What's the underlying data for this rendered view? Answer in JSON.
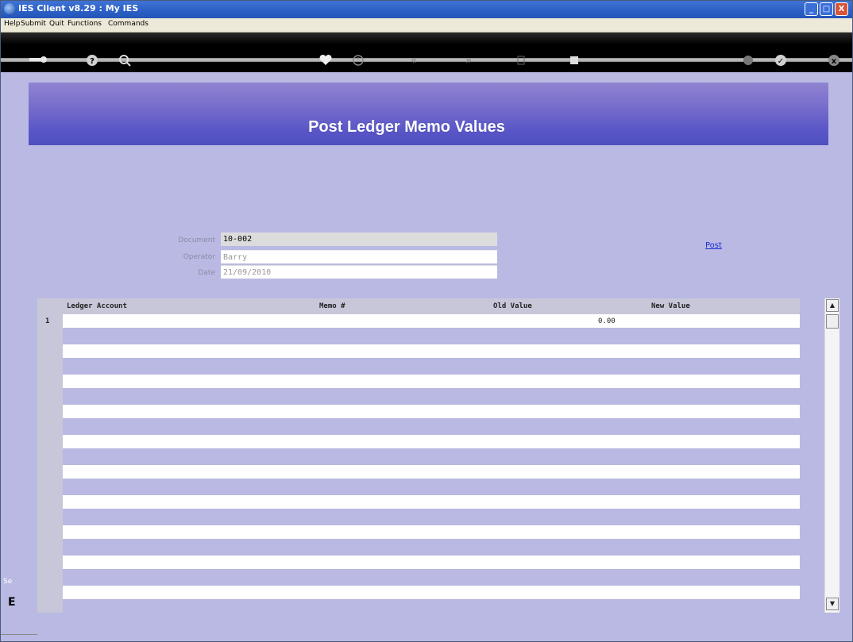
{
  "window": {
    "title": "IES Client v8.29 : My IES",
    "controls": {
      "minimize": "_",
      "maximize": "□",
      "close": "X"
    }
  },
  "menu": {
    "items": [
      "Help",
      "Submit",
      "Quit",
      "Functions",
      "Commands"
    ]
  },
  "toolbar": {
    "icons": [
      "key-icon",
      "help-icon",
      "search-icon",
      "heart-icon",
      "clock-icon",
      "rewind-icon",
      "forward-icon",
      "export-icon",
      "stop-icon",
      "print-icon",
      "check-icon",
      "close-icon"
    ],
    "glyphs": {
      "help": "?",
      "check": "✓",
      "close": "x",
      "rewind": "«",
      "forward": "»"
    }
  },
  "banner": {
    "title": "Post Ledger Memo Values"
  },
  "form": {
    "document_label": "Document",
    "document_value": "10-002",
    "operator_label": "Operator",
    "operator_value": "Barry",
    "date_label": "Date",
    "date_value": "21/09/2010"
  },
  "actions": {
    "post_label": "Post"
  },
  "grid": {
    "columns": [
      "Ledger Account",
      "Memo #",
      "Old Value",
      "New Value"
    ],
    "rows": [
      {
        "num": "1",
        "ledger_account": "",
        "memo": "",
        "old_value": "0.00",
        "new_value": ""
      }
    ]
  },
  "left_edge": {
    "text": "Se",
    "char": "E"
  },
  "colors": {
    "titlebar": "#2b5fc4",
    "background": "#b9b9e3",
    "banner": "#6a62c8",
    "link": "#1a2fd0"
  }
}
